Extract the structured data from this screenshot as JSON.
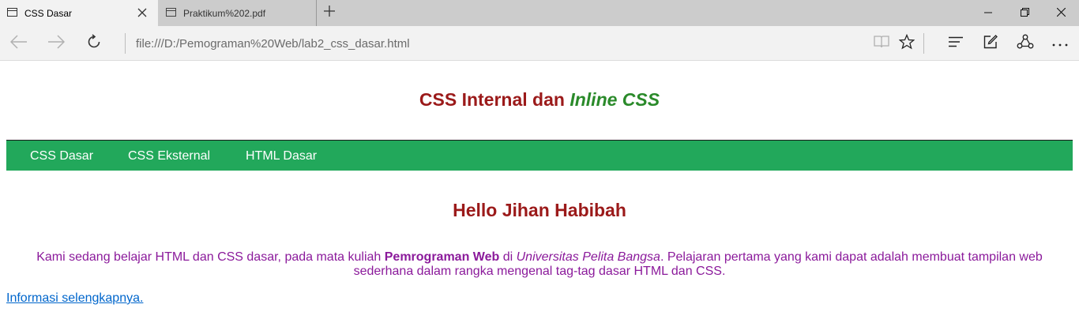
{
  "tabs": [
    {
      "title": "CSS Dasar",
      "active": true
    },
    {
      "title": "Praktikum%202.pdf",
      "active": false
    }
  ],
  "address": {
    "url": "file:///D:/Pemograman%20Web/lab2_css_dasar.html"
  },
  "icons": {
    "tab_page": "page-icon",
    "close": "close-icon",
    "new_tab": "plus-icon",
    "minimize": "minimize-icon",
    "restore": "restore-icon",
    "window_close": "close-icon",
    "back": "back-arrow-icon",
    "forward": "forward-arrow-icon",
    "refresh": "refresh-icon",
    "reading_view": "book-icon",
    "favorite": "star-icon",
    "hub": "hub-icon",
    "web_note": "pen-icon",
    "share": "share-icon",
    "more": "more-icon"
  },
  "page": {
    "title_main": "CSS Internal dan ",
    "title_accent": "Inline CSS",
    "menu": [
      {
        "label": "CSS Dasar"
      },
      {
        "label": "CSS Eksternal"
      },
      {
        "label": "HTML Dasar"
      }
    ],
    "greeting": "Hello Jihan Habibah",
    "intro": {
      "part1": "Kami sedang belajar HTML dan CSS dasar, pada mata kuliah ",
      "bold": "Pemrograman Web",
      "part2": " di ",
      "italic": "Universitas Pelita Bangsa",
      "part3": ". Pelajaran pertama yang kami dapat adalah membuat tampilan web sederhana dalam rangka mengenal tag-tag dasar HTML dan CSS."
    },
    "link": "Informasi selengkapnya."
  },
  "colors": {
    "title": "#9b1a1a",
    "title_accent": "#2a8a2a",
    "menu_bg": "#22a85b",
    "intro_text": "#8b1a9b",
    "link": "#0066cc"
  }
}
